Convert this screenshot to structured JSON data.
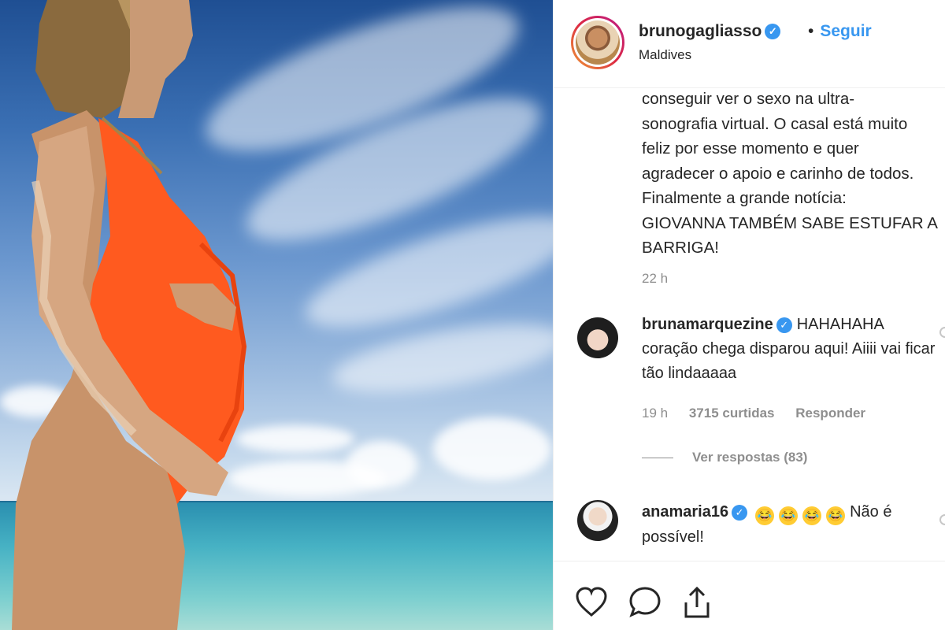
{
  "post": {
    "username": "brunogagliasso",
    "verified_glyph": "✓",
    "separator": "•",
    "follow_label": "Seguir",
    "location": "Maldives"
  },
  "caption": {
    "lines": [
      "conseguir ver o sexo na ultra-",
      "sonografia virtual. O casal está muito",
      "feliz por esse momento e quer",
      "agradecer o apoio e carinho de todos.",
      "Finalmente a grande notícia:",
      "GIOVANNA TAMBÉM SABE ESTUFAR A",
      "BARRIGA!"
    ],
    "time": "22 h"
  },
  "comments": [
    {
      "username": "brunamarquezine",
      "text": "HAHAHAHA coração chega disparou aqui! Aiiii vai ficar tão lindaaaaa",
      "time": "19 h",
      "likes": "3715 curtidas",
      "reply_label": "Responder",
      "view_replies": "Ver respostas (83)"
    },
    {
      "username": "anamaria16",
      "emoji": "😂",
      "text": "Não é possível!"
    }
  ],
  "actions": {
    "like_icon": "heart-icon",
    "comment_icon": "comment-icon",
    "share_icon": "share-icon"
  },
  "colors": {
    "accent": "#3897f0",
    "swimsuit": "#ff5a1f",
    "muted": "#8e8e8e"
  }
}
